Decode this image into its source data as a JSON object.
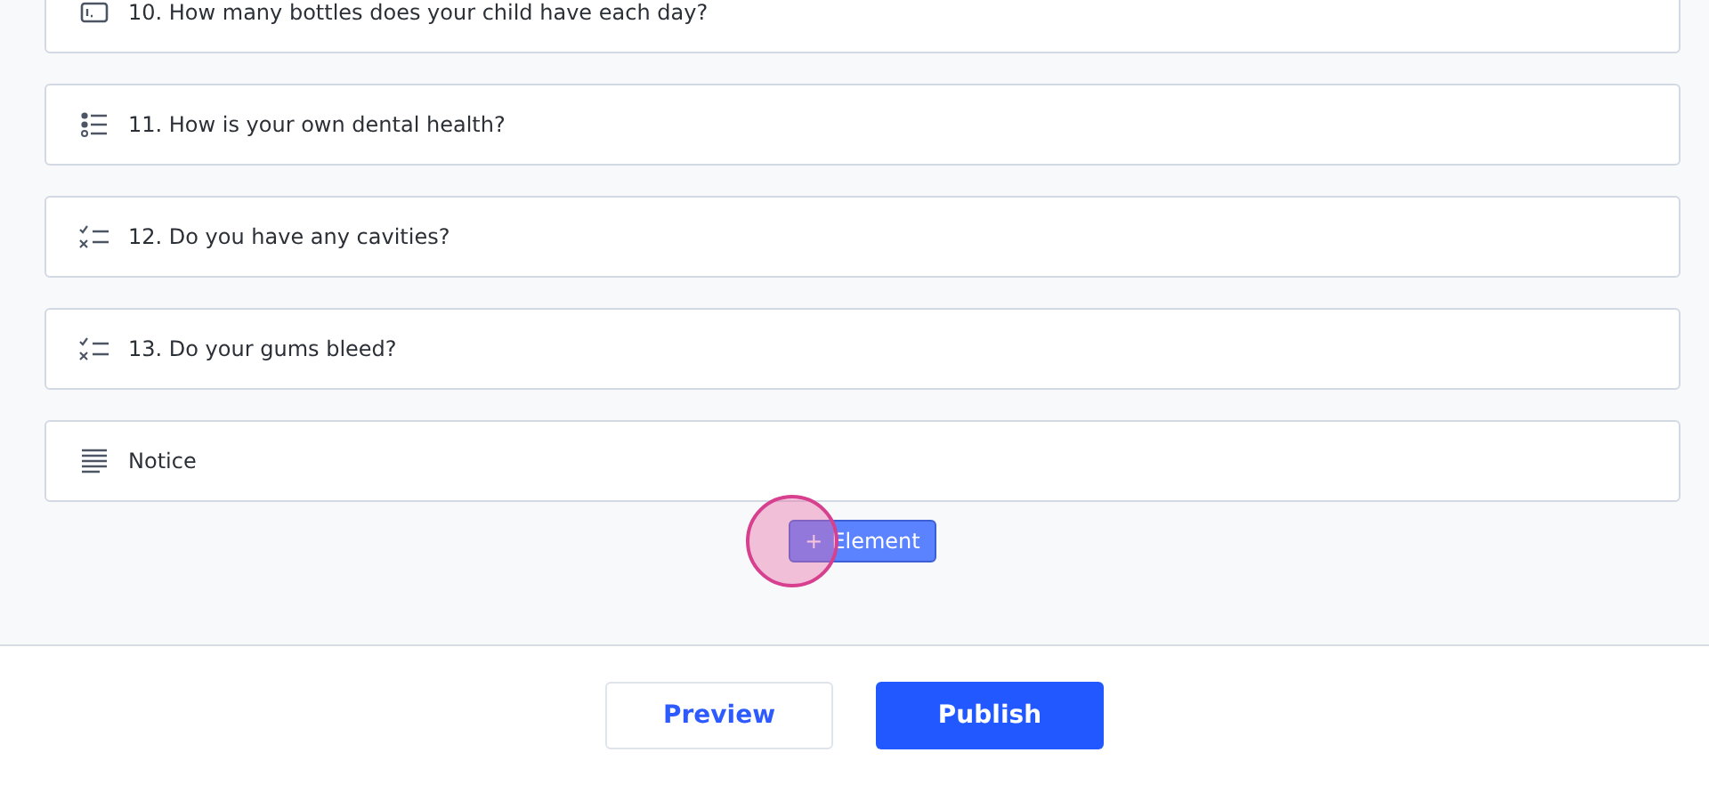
{
  "elements": [
    {
      "kind": "number",
      "label": "10. How many bottles does your child have each day?"
    },
    {
      "kind": "choice",
      "label": "11. How is your own dental health?"
    },
    {
      "kind": "checklist",
      "label": "12. Do you have any cavities?"
    },
    {
      "kind": "checklist",
      "label": "13. Do your gums bleed?"
    },
    {
      "kind": "text",
      "label": "Notice"
    }
  ],
  "add_button": {
    "icon": "+",
    "label": "Element",
    "pressed": true
  },
  "footer": {
    "preview": "Preview",
    "publish": "Publish"
  }
}
